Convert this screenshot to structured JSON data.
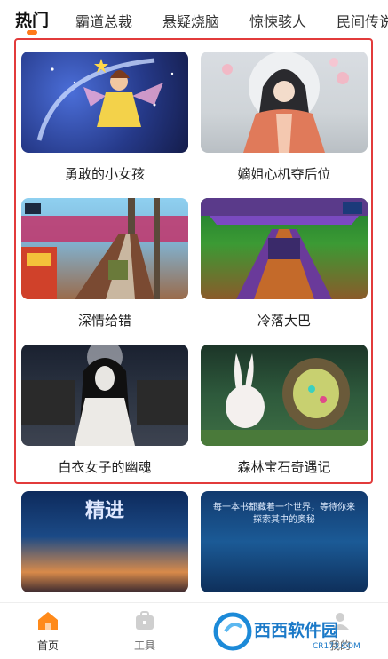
{
  "tabs": [
    {
      "label": "热门"
    },
    {
      "label": "霸道总裁"
    },
    {
      "label": "悬疑烧脑"
    },
    {
      "label": "惊悚骇人"
    },
    {
      "label": "民间传说"
    }
  ],
  "grid": [
    {
      "title": "勇敢的小女孩"
    },
    {
      "title": "嫡姐心机夺后位"
    },
    {
      "title": "深情给错"
    },
    {
      "title": "冷落大巴"
    },
    {
      "title": "白衣女子的幽魂"
    },
    {
      "title": "森林宝石奇遇记"
    }
  ],
  "partial_thumbs": [
    {
      "text": "精进"
    },
    {
      "text": "每一本书都藏着一个世界，等待你来探索其中的奥秘"
    }
  ],
  "bottom_nav": [
    {
      "label": "首页"
    },
    {
      "label": "工具"
    },
    {
      "label": "我的"
    }
  ],
  "watermark": {
    "text": "西西软件园",
    "sub": "CR173.COM"
  },
  "colors": {
    "accent": "#ff7a1a",
    "highlight": "#e23b3b"
  }
}
